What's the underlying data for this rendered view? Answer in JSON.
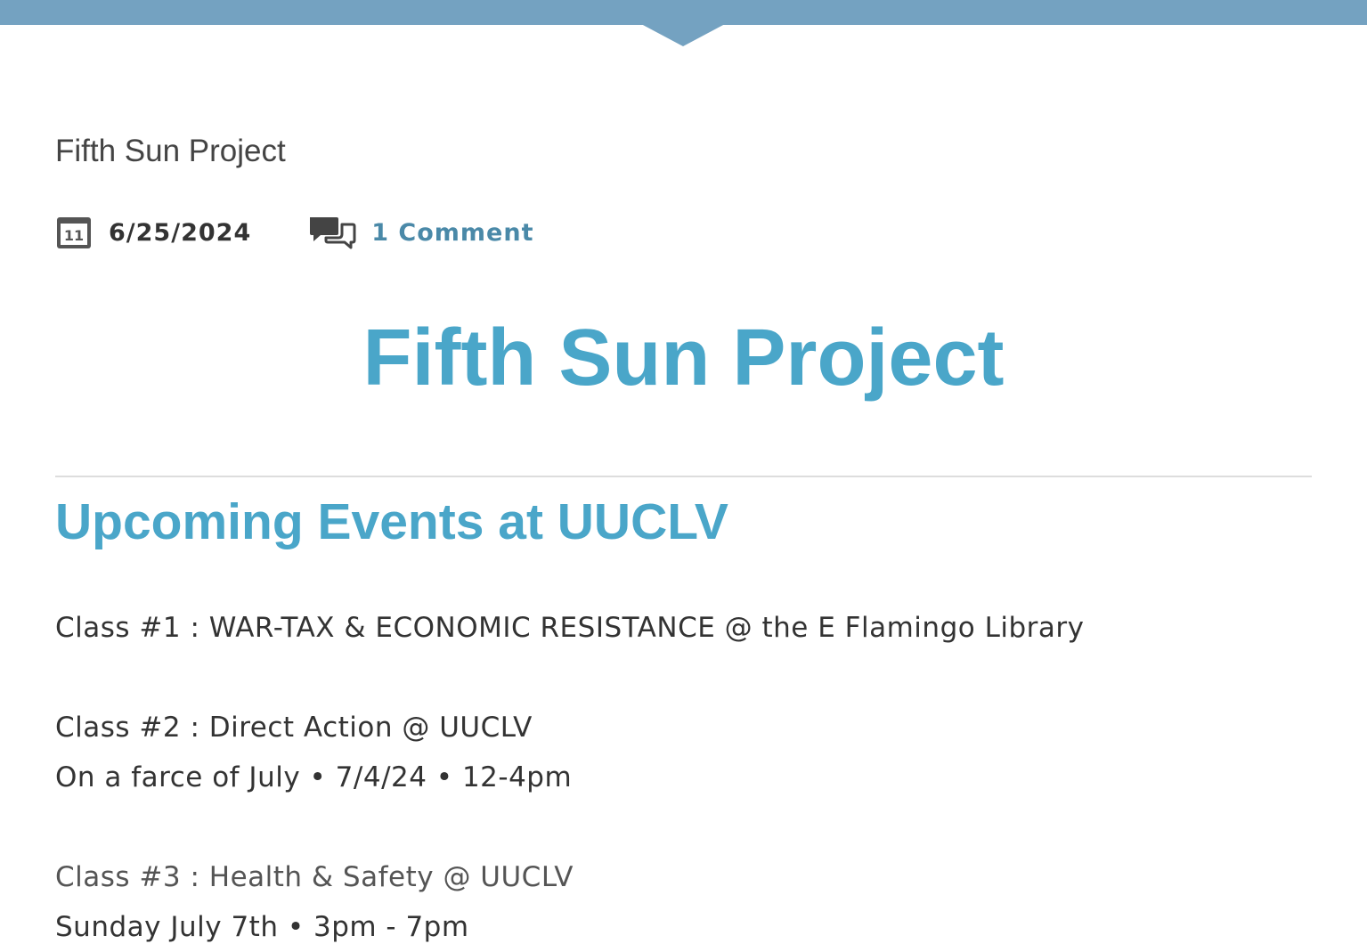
{
  "site": {
    "name": "Fifth Sun Project"
  },
  "meta": {
    "date": "6/25/2024",
    "date_icon": "calendar-icon",
    "date_icon_day": "11",
    "comments_label": "1 Comment",
    "comments_icon": "comments-icon"
  },
  "post": {
    "title": "Fifth Sun Project",
    "section_heading": "Upcoming Events at UUCLV",
    "lines": [
      "Class #1 : WAR-TAX & ECONOMIC RESISTANCE @ the E Flamingo Library",
      "Class #2 : Direct Action @ UUCLV",
      "On a farce of July • 7/4/24 • 12-4pm",
      "Class #3 : Health & Safety @ UUCLV",
      "Sunday July 7th • 3pm - 7pm"
    ]
  },
  "colors": {
    "topbar": "#74a2c1",
    "accent": "#4aa6c9",
    "link": "#4a89a8",
    "text": "#333333"
  }
}
